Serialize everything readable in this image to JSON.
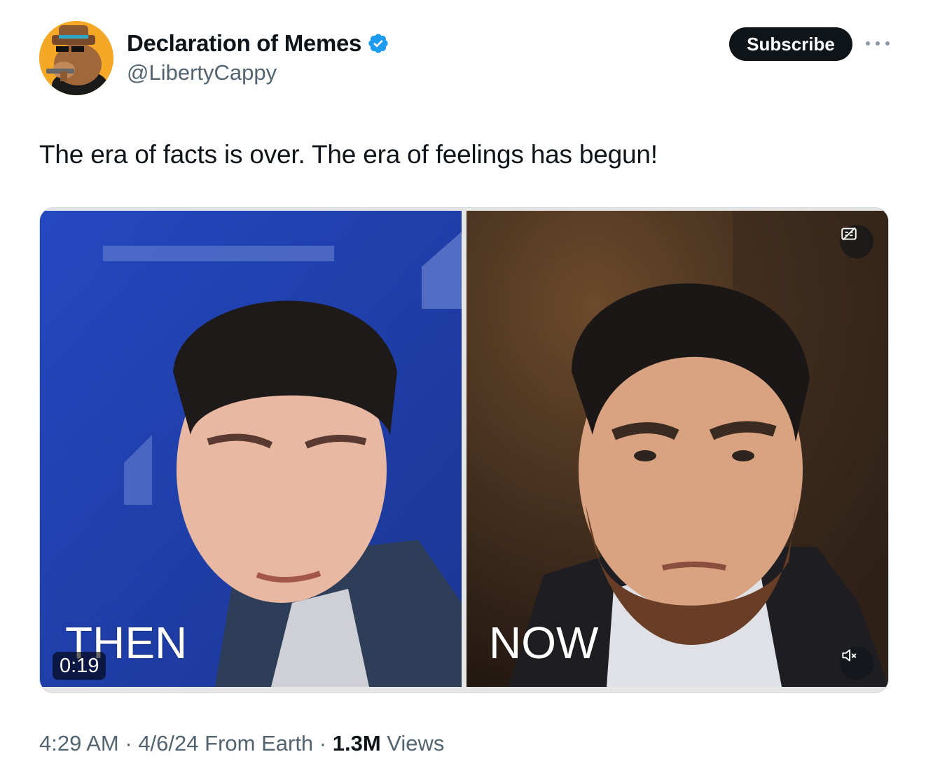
{
  "author": {
    "display_name": "Declaration of Memes",
    "handle": "@LibertyCappy",
    "verified": true,
    "avatar_icon": "cowboy-capybara-avatar-icon"
  },
  "actions": {
    "subscribe_label": "Subscribe",
    "more_icon": "more-options-icon"
  },
  "tweet": {
    "text": "The era of facts is over. The era of feelings has begun!"
  },
  "media": {
    "left_caption": "THEN",
    "right_caption": "NOW",
    "duration": "0:19",
    "cc_icon": "captions-off-icon",
    "mute_icon": "muted-speaker-icon"
  },
  "meta": {
    "time": "4:29 AM",
    "date": "4/6/24",
    "source": "From Earth",
    "separator": " · ",
    "views_count": "1.3M",
    "views_label": "Views"
  },
  "colors": {
    "text_primary": "#0f1419",
    "text_secondary": "#536471",
    "verified_blue": "#1d9bf0",
    "button_dark": "#0f1419"
  }
}
